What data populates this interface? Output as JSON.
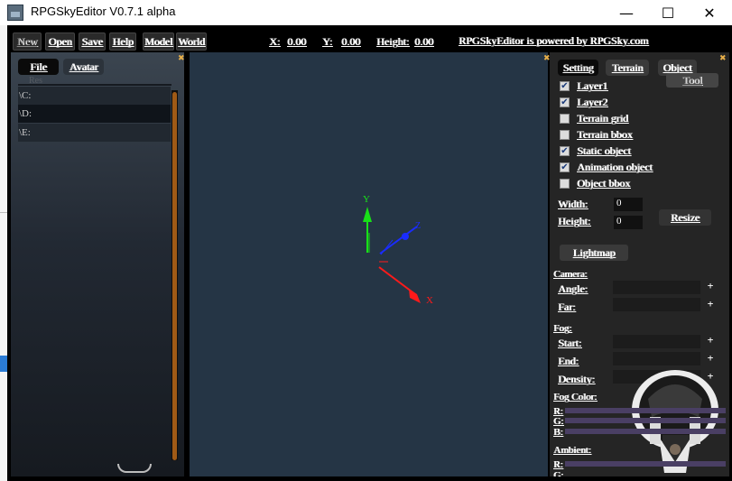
{
  "window": {
    "title": "RPGSkyEditor V0.7.1 alpha",
    "min_glyph": "—",
    "max_glyph": "☐",
    "close_glyph": "✕"
  },
  "menu": {
    "items": [
      "New",
      "Open",
      "Save",
      "Help",
      "Model",
      "World"
    ],
    "x_label": "X:",
    "x_value": "0.00",
    "y_label": "Y:",
    "y_value": "0.00",
    "height_label": "Height:",
    "height_value": "0.00",
    "credit": "RPGSkyEditor is powered by RPGSky.com"
  },
  "left_panel": {
    "tabs": [
      "File",
      "Avatar"
    ],
    "faint_label": "Res",
    "rows": [
      "\\C:",
      "\\D:",
      "\\E:"
    ]
  },
  "viewport": {
    "axis_y": "Y",
    "axis_x": "X",
    "axis_z": "Z",
    "axis_colors": {
      "x": "#ff1a1a",
      "y": "#18e018",
      "z": "#1a2cff"
    }
  },
  "right_panel": {
    "tabs": [
      "Setting",
      "Terrain",
      "Object"
    ],
    "tool_label": "Tool",
    "checkboxes": [
      {
        "label": "Layer1",
        "checked": true
      },
      {
        "label": "Layer2",
        "checked": true
      },
      {
        "label": "Terrain grid",
        "checked": false
      },
      {
        "label": "Terrain bbox",
        "checked": false
      },
      {
        "label": "Static object",
        "checked": true
      },
      {
        "label": "Animation object",
        "checked": true
      },
      {
        "label": "Object bbox",
        "checked": false
      }
    ],
    "check_mark": "✔",
    "width_label": "Width:",
    "width_value": "0",
    "height_label": "Height:",
    "height_value": "0",
    "resize_label": "Resize",
    "lightmap_label": "Lightmap",
    "camera_header": "Camera:",
    "angle_label": "Angle:",
    "far_label": "Far:",
    "fog_header": "Fog:",
    "start_label": "Start:",
    "end_label": "End:",
    "density_label": "Density:",
    "fog_color_header": "Fog Color:",
    "r_label": "R:",
    "g_label": "G:",
    "b_label": "B:",
    "ambient_header": "Ambient:",
    "ambient_r_label": "R:",
    "ambient_g_label": "G:",
    "plus_glyph": "+"
  }
}
